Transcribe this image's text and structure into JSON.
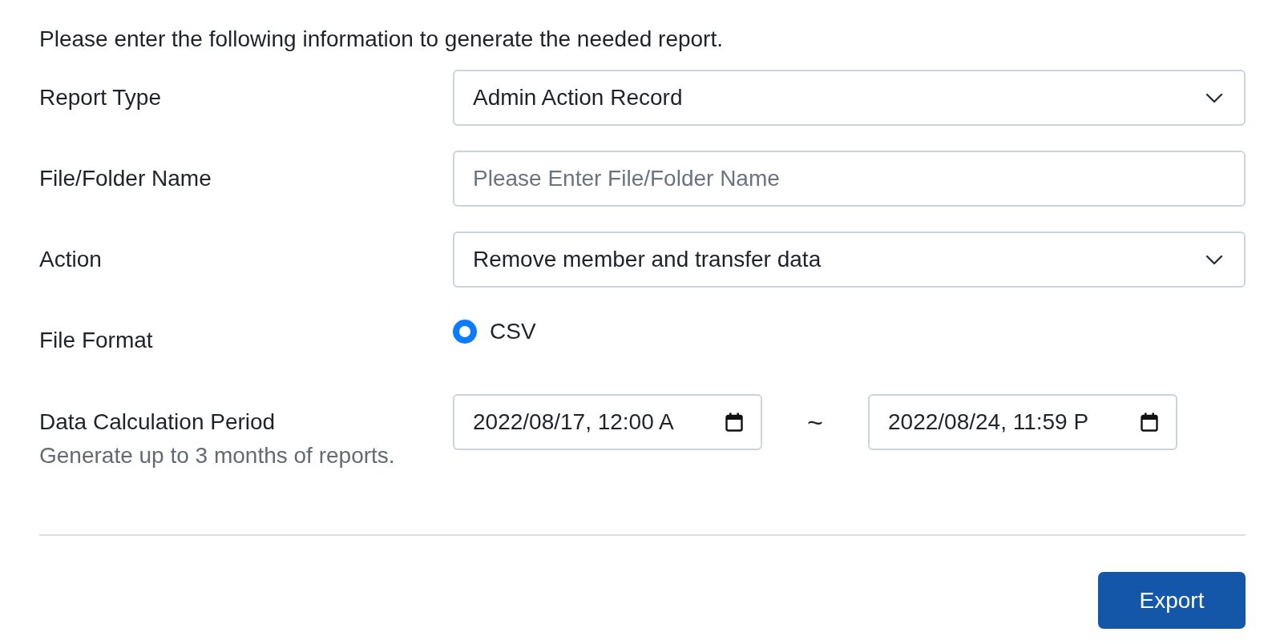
{
  "intro": "Please enter the following information to generate the needed report.",
  "fields": [
    {
      "kind": "select",
      "label": "Report Type",
      "value": "Admin Action Record"
    },
    {
      "kind": "text",
      "label": "File/Folder Name",
      "placeholder": "Please Enter File/Folder Name"
    },
    {
      "kind": "select",
      "label": "Action",
      "value": "Remove member and transfer data"
    },
    {
      "kind": "radio",
      "label": "File Format",
      "options": [
        {
          "label": "CSV",
          "selected": true
        }
      ]
    },
    {
      "kind": "daterange",
      "label": "Data Calculation Period",
      "hint": "Generate up to 3 months of reports.",
      "start": "2022/08/17, 12:00 A",
      "separator": "~",
      "end": "2022/08/24, 11:59 P"
    }
  ],
  "buttons": [
    {
      "label": "Export"
    }
  ]
}
